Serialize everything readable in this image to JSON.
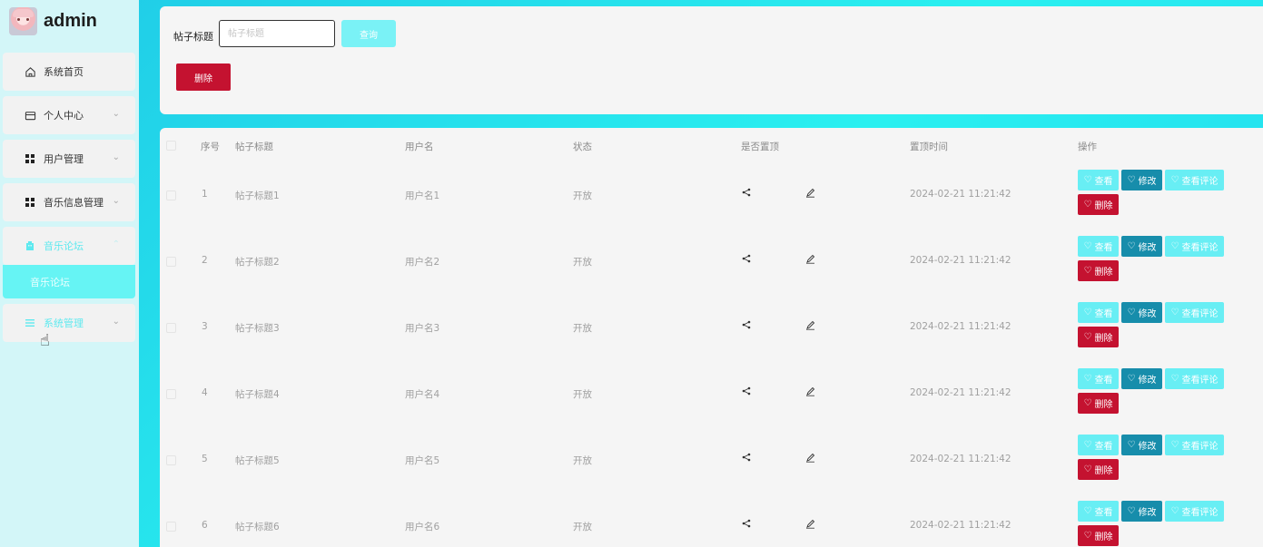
{
  "brand": {
    "name": "admin"
  },
  "sidebar": {
    "items": [
      {
        "label": "系统首页",
        "icon": "home-icon",
        "has_chevron": false,
        "chevron": ""
      },
      {
        "label": "个人中心",
        "icon": "card-icon",
        "has_chevron": true,
        "chevron": "⌄"
      },
      {
        "label": "用户管理",
        "icon": "grid-icon",
        "has_chevron": true,
        "chevron": "⌄"
      },
      {
        "label": "音乐信息管理",
        "icon": "grid-icon",
        "has_chevron": true,
        "chevron": "⌄"
      },
      {
        "label": "音乐论坛",
        "icon": "building-icon",
        "has_chevron": true,
        "chevron": "⌃"
      },
      {
        "label": "系统管理",
        "icon": "list-icon",
        "has_chevron": true,
        "chevron": "⌄"
      }
    ],
    "submenu": {
      "label": "音乐论坛"
    }
  },
  "search": {
    "label": "帖子标题",
    "placeholder": "帖子标题",
    "value": "",
    "query_button": "查询",
    "delete_button": "删除"
  },
  "table": {
    "headers": [
      "序号",
      "帖子标题",
      "用户名",
      "状态",
      "是否置顶",
      "置顶时间",
      "操作"
    ],
    "rows": [
      {
        "index": "1",
        "title": "帖子标题1",
        "username": "用户名1",
        "status": "开放",
        "pinned_time": "2024-02-21 11:21:42"
      },
      {
        "index": "2",
        "title": "帖子标题2",
        "username": "用户名2",
        "status": "开放",
        "pinned_time": "2024-02-21 11:21:42"
      },
      {
        "index": "3",
        "title": "帖子标题3",
        "username": "用户名3",
        "status": "开放",
        "pinned_time": "2024-02-21 11:21:42"
      },
      {
        "index": "4",
        "title": "帖子标题4",
        "username": "用户名4",
        "status": "开放",
        "pinned_time": "2024-02-21 11:21:42"
      },
      {
        "index": "5",
        "title": "帖子标题5",
        "username": "用户名5",
        "status": "开放",
        "pinned_time": "2024-02-21 11:21:42"
      },
      {
        "index": "6",
        "title": "帖子标题6",
        "username": "用户名6",
        "status": "开放",
        "pinned_time": "2024-02-21 11:21:42"
      }
    ],
    "actions": {
      "view": "查看",
      "edit": "修改",
      "comments": "查看评论",
      "delete": "删除"
    }
  },
  "colors": {
    "accent": "#68eef4",
    "edit": "#178dab",
    "danger": "#c41230",
    "sidebar_bg": "#d3f6f8"
  }
}
